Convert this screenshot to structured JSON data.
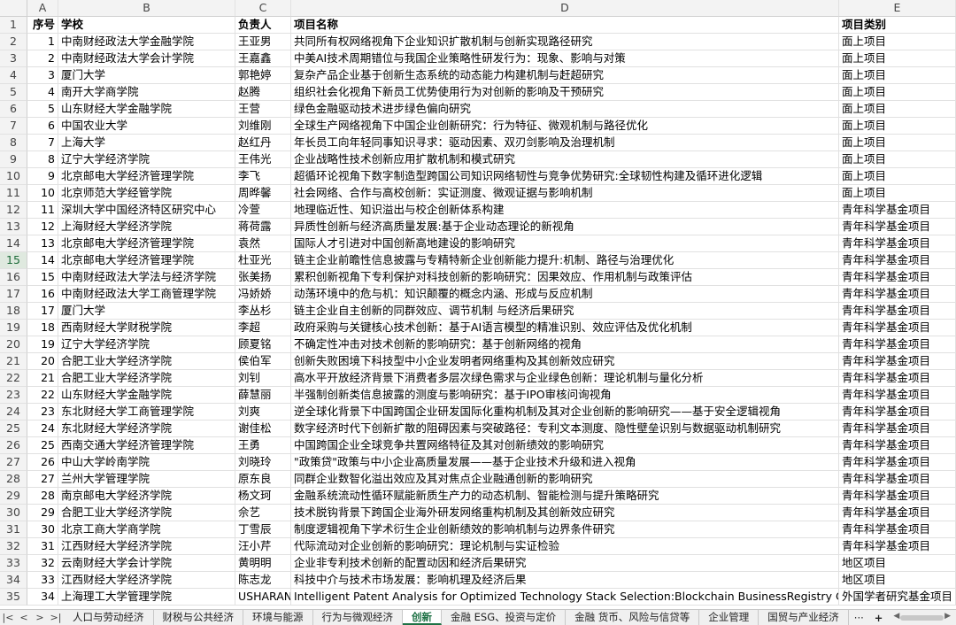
{
  "columns": [
    "A",
    "B",
    "C",
    "D",
    "E"
  ],
  "headers": [
    "序号",
    "学校",
    "负责人",
    "项目名称",
    "项目类别"
  ],
  "rows": [
    [
      "1",
      "中南财经政法大学金融学院",
      "王亚男",
      "共同所有权网络视角下企业知识扩散机制与创新实现路径研究",
      "面上项目"
    ],
    [
      "2",
      "中南财经政法大学会计学院",
      "王嘉鑫",
      "中美AI技术周期错位与我国企业策略性研发行为：现象、影响与对策",
      "面上项目"
    ],
    [
      "3",
      "厦门大学",
      "郭艳婷",
      "复杂产品企业基于创新生态系统的动态能力构建机制与赶超研究",
      "面上项目"
    ],
    [
      "4",
      "南开大学商学院",
      "赵腾",
      "组织社会化视角下新员工优势使用行为对创新的影响及干预研究",
      "面上项目"
    ],
    [
      "5",
      "山东财经大学金融学院",
      "王营",
      "绿色金融驱动技术进步绿色偏向研究",
      "面上项目"
    ],
    [
      "6",
      "中国农业大学",
      "刘维刚",
      "全球生产网络视角下中国企业创新研究：行为特征、微观机制与路径优化",
      "面上项目"
    ],
    [
      "7",
      "上海大学",
      "赵红丹",
      "年长员工向年轻同事知识寻求：驱动因素、双刃剑影响及治理机制",
      "面上项目"
    ],
    [
      "8",
      "辽宁大学经济学院",
      "王伟光",
      "企业战略性技术创新应用扩散机制和模式研究",
      "面上项目"
    ],
    [
      "9",
      "北京邮电大学经济管理学院",
      "李飞",
      "超循环论视角下数字制造型跨国公司知识网络韧性与竞争优势研究:全球韧性构建及循环进化逻辑",
      "面上项目"
    ],
    [
      "10",
      "北京师范大学经管学院",
      "周晔馨",
      "社会网络、合作与高校创新：实证测度、微观证据与影响机制",
      "面上项目"
    ],
    [
      "11",
      "深圳大学中国经济特区研究中心",
      "冷萱",
      "地理临近性、知识溢出与校企创新体系构建",
      "青年科学基金项目"
    ],
    [
      "12",
      "上海财经大学经济学院",
      "蒋荷露",
      "异质性创新与经济高质量发展:基于企业动态理论的新视角",
      "青年科学基金项目"
    ],
    [
      "13",
      "北京邮电大学经济管理学院",
      "袁然",
      "国际人才引进对中国创新高地建设的影响研究",
      "青年科学基金项目"
    ],
    [
      "14",
      "北京邮电大学经济管理学院",
      "杜亚光",
      "链主企业前瞻性信息披露与专精特新企业创新能力提升:机制、路径与治理优化",
      "青年科学基金项目"
    ],
    [
      "15",
      "中南财经政法大学法与经济学院",
      "张美扬",
      "累积创新视角下专利保护对科技创新的影响研究：因果效应、作用机制与政策评估",
      "青年科学基金项目"
    ],
    [
      "16",
      "中南财经政法大学工商管理学院",
      "冯娇娇",
      "动荡环境中的危与机：知识颠覆的概念内涵、形成与反应机制",
      "青年科学基金项目"
    ],
    [
      "17",
      "厦门大学",
      "李丛杉",
      "链主企业自主创新的同群效应、调节机制 与经济后果研究",
      "青年科学基金项目"
    ],
    [
      "18",
      "西南财经大学财税学院",
      "李超",
      "政府采购与关键核心技术创新：基于AI语言模型的精准识别、效应评估及优化机制",
      "青年科学基金项目"
    ],
    [
      "19",
      "辽宁大学经济学院",
      "顾夏铭",
      "不确定性冲击对技术创新的影响研究：基于创新网络的视角",
      "青年科学基金项目"
    ],
    [
      "20",
      "合肥工业大学经济学院",
      "侯伯军",
      "创新失败困境下科技型中小企业发明者网络重构及其创新效应研究",
      "青年科学基金项目"
    ],
    [
      "21",
      "合肥工业大学经济学院",
      "刘钊",
      "高水平开放经济背景下消费者多层次绿色需求与企业绿色创新：理论机制与量化分析",
      "青年科学基金项目"
    ],
    [
      "22",
      "山东财经大学金融学院",
      "薛慧丽",
      "半强制创新类信息披露的测度与影响研究：基于IPO审核问询视角",
      "青年科学基金项目"
    ],
    [
      "23",
      "东北财经大学工商管理学院",
      "刘爽",
      "逆全球化背景下中国跨国企业研发国际化重构机制及其对企业创新的影响研究——基于安全逻辑视角",
      "青年科学基金项目"
    ],
    [
      "24",
      "东北财经大学经济学院",
      "谢佳松",
      "数字经济时代下创新扩散的阻碍因素与突破路径：专利文本测度、隐性壁垒识别与数据驱动机制研究",
      "青年科学基金项目"
    ],
    [
      "25",
      "西南交通大学经济管理学院",
      "王勇",
      "中国跨国企业全球竞争共置网络特征及其对创新绩效的影响研究",
      "青年科学基金项目"
    ],
    [
      "26",
      "中山大学岭南学院",
      "刘晓玲",
      "\"政策贷\"政策与中小企业高质量发展——基于企业技术升级和进入视角",
      "青年科学基金项目"
    ],
    [
      "27",
      "兰州大学管理学院",
      "原东良",
      "同群企业数智化溢出效应及其对焦点企业融通创新的影响研究",
      "青年科学基金项目"
    ],
    [
      "28",
      "南京邮电大学经济学院",
      "杨文珂",
      "金融系统流动性循环赋能新质生产力的动态机制、智能检测与提升策略研究",
      "青年科学基金项目"
    ],
    [
      "29",
      "合肥工业大学经济学院",
      "佘艺",
      "技术脱钩背景下跨国企业海外研发网络重构机制及其创新效应研究",
      "青年科学基金项目"
    ],
    [
      "30",
      "北京工商大学商学院",
      "丁雪辰",
      "制度逻辑视角下学术衍生企业创新绩效的影响机制与边界条件研究",
      "青年科学基金项目"
    ],
    [
      "31",
      "江西财经大学经济学院",
      "汪小芹",
      "代际流动对企业创新的影响研究：理论机制与实证检验",
      "青年科学基金项目"
    ],
    [
      "32",
      "云南财经大学会计学院",
      "黄明明",
      "企业非专利技术创新的配置动因和经济后果研究",
      "地区项目"
    ],
    [
      "33",
      "江西财经大学经济学院",
      "陈志龙",
      "科技中介与技术市场发展：影响机理及经济后果",
      "地区项目"
    ],
    [
      "34",
      "上海理工大学管理学院",
      "USHARAN",
      "Intelligent Patent Analysis for Optimized Technology Stack Selection:Blockchain BusinessRegistry Case Demonstration",
      "外国学者研究基金项目"
    ]
  ],
  "row_numbers": [
    "1",
    "2",
    "3",
    "4",
    "5",
    "6",
    "7",
    "8",
    "9",
    "10",
    "11",
    "12",
    "13",
    "14",
    "15",
    "16",
    "17",
    "18",
    "19",
    "20",
    "21",
    "22",
    "23",
    "24",
    "25",
    "26",
    "27",
    "28",
    "29",
    "30",
    "31",
    "32",
    "33",
    "34",
    "35"
  ],
  "selected_row": 14,
  "sheet_tabs": [
    "人口与劳动经济",
    "财税与公共经济",
    "环境与能源",
    "行为与微观经济",
    "创新",
    "金融 ESG、投资与定价",
    "金融 货币、风险与信贷等",
    "企业管理",
    "国贸与产业经济"
  ],
  "active_tab": "创新",
  "nav": {
    "first": "|<",
    "prev": "<",
    "next": ">",
    "last": ">|",
    "more": "···",
    "add": "+"
  },
  "colors": {
    "accent": "#1e7145",
    "header_bg": "#f3f3f3",
    "grid": "#e1e1e1"
  }
}
